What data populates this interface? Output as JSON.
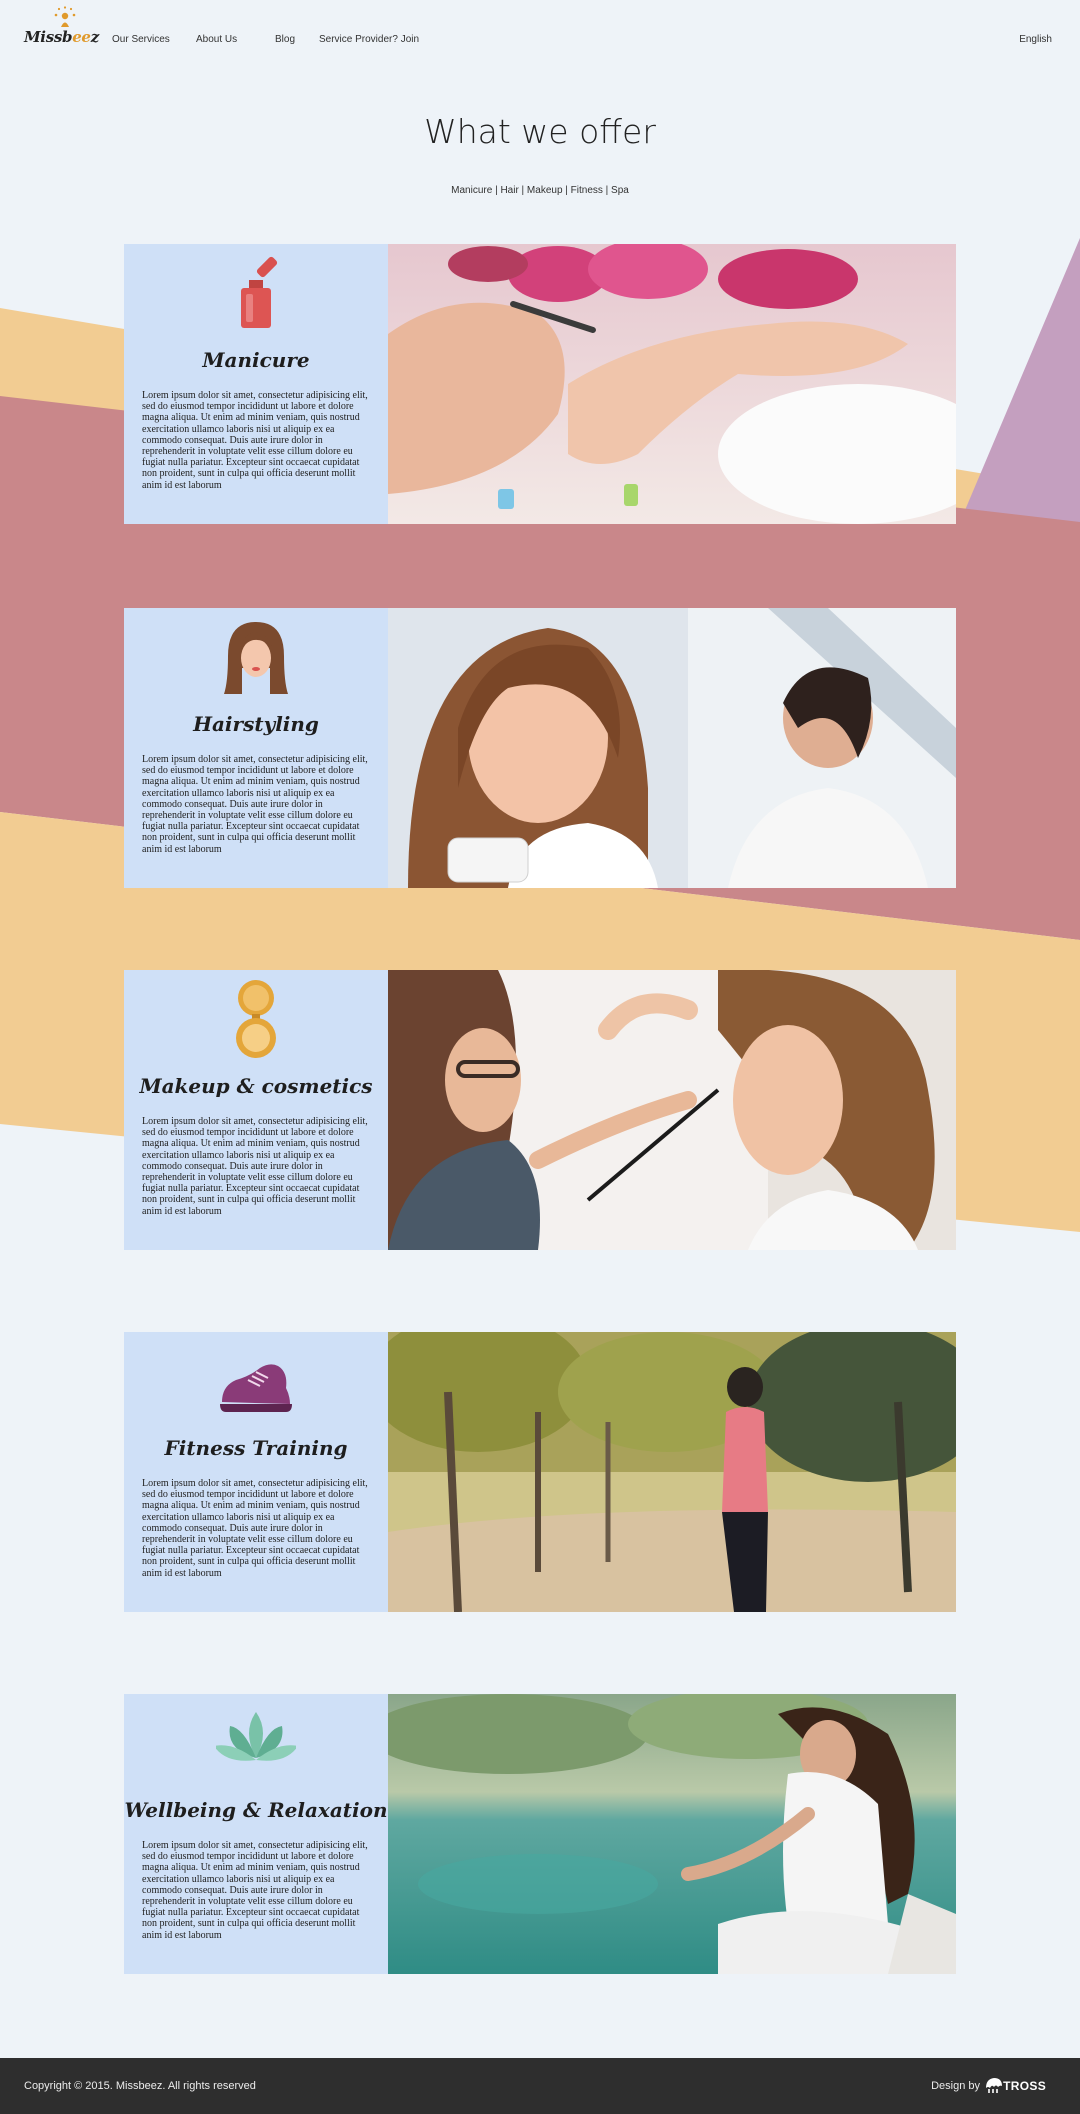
{
  "header": {
    "logo_prefix": "Missb",
    "logo_accent": "ee",
    "logo_suffix": "z",
    "nav": [
      "Our Services",
      "About Us",
      "Blog",
      "Service Provider? Join"
    ],
    "language": "English"
  },
  "main": {
    "title": "What we offer",
    "subtitle": "Manicure | Hair | Makeup | Fitness | Spa",
    "lorem": "Lorem ipsum dolor sit amet, consectetur adipisicing elit, sed do eiusmod tempor incididunt ut labore et dolore magna aliqua. Ut enim ad minim veniam, quis nostrud exercitation ullamco laboris nisi ut aliquip ex ea commodo consequat. Duis aute irure dolor in reprehenderit in voluptate velit esse cillum dolore eu fugiat nulla pariatur. Excepteur sint occaecat cupidatat non proident, sunt in culpa qui officia deserunt mollit anim id est laborum",
    "services": [
      {
        "title": "Manicure",
        "icon": "nail-polish-icon",
        "photo": "manicure-photo"
      },
      {
        "title": "Hairstyling",
        "icon": "woman-hair-icon",
        "photo": "hairstyling-photo"
      },
      {
        "title": "Makeup & cosmetics",
        "icon": "compact-mirror-icon",
        "photo": "makeup-photo"
      },
      {
        "title": "Fitness Training",
        "icon": "sneaker-icon",
        "photo": "fitness-photo"
      },
      {
        "title": "Wellbeing & Relaxation",
        "icon": "lotus-icon",
        "photo": "relaxation-photo"
      }
    ]
  },
  "footer": {
    "copyright": "Copyright © 2015. Missbeez. All rights reserved",
    "design_by": "Design by",
    "designer": "TROSS"
  },
  "colors": {
    "page_bg": "#eef3f8",
    "panel": "#cfe0f7",
    "band_peach": "#f2cc92",
    "band_rose": "#c9878a",
    "band_lilac": "#c49fbf",
    "logo_accent": "#e09a2c",
    "footer_bg": "#2e2e2e"
  }
}
